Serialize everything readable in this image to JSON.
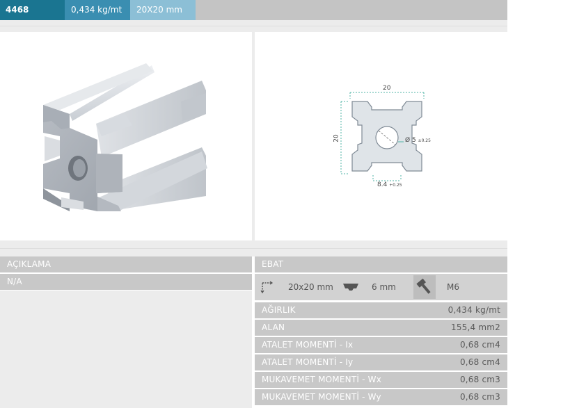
{
  "header": {
    "code": "4468",
    "weight": "0,434 kg/mt",
    "size": "20X20 mm"
  },
  "drawing": {
    "width_label": "20",
    "height_label": "20",
    "hole_label": "Ø 5",
    "hole_tol": "±0.25",
    "slot_label": "8.4",
    "slot_tol": "+0.25"
  },
  "left_table": {
    "title": "AÇIKLAMA",
    "value": "N/A"
  },
  "ebat": {
    "title": "EBAT",
    "dimension": "20x20 mm",
    "slot": "6 mm",
    "bolt": "M6"
  },
  "specs": [
    {
      "label": "AĞIRLIK",
      "value": "0,434 kg/mt"
    },
    {
      "label": "ALAN",
      "value": "155,4 mm2"
    },
    {
      "label": "ATALET MOMENTİ - Ix",
      "value": "0,68 cm4"
    },
    {
      "label": "ATALET MOMENTİ - Iy",
      "value": "0,68 cm4"
    },
    {
      "label": "MUKAVEMET MOMENTİ - Wx",
      "value": "0,68 cm3"
    },
    {
      "label": "MUKAVEMET MOMENTİ - Wy",
      "value": "0,68 cm3"
    }
  ],
  "colors": {
    "code_bg": "#1a7591",
    "weight_bg": "#3a8eb1",
    "size_bg": "#8cbfd6",
    "dimension_line": "#4fb3a6"
  }
}
